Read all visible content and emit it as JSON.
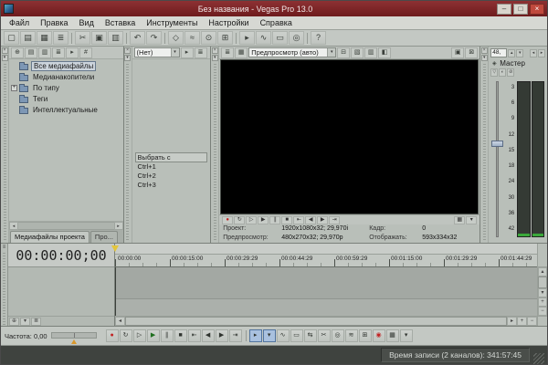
{
  "glyphs": {
    "minimize": "–",
    "maximize": "□",
    "close": "×",
    "pin": "▾",
    "tri_up": "▴",
    "tri_down": "▾",
    "tri_left": "◂",
    "tri_right": "▸",
    "up": "▲",
    "down": "▼",
    "left": "◀",
    "right": "▶",
    "plus": "+",
    "minus": "−",
    "hamburger": "≡",
    "expand": "+",
    "record": "●",
    "loop": "↻",
    "play_from_start": "▷",
    "play": "▶",
    "pause": "∥",
    "stop": "■",
    "go_to_start": "⇤",
    "prev_frame": "◀",
    "next_frame": "▶",
    "go_to_end": "⇥"
  },
  "titlebar": {
    "title": "Без названия - Vegas Pro 13.0"
  },
  "menu": {
    "items": [
      "Файл",
      "Правка",
      "Вид",
      "Вставка",
      "Инструменты",
      "Настройки",
      "Справка"
    ]
  },
  "toolbar": {
    "glyphs": [
      "▢",
      "▤",
      "▦",
      "≣",
      "✂",
      "▣",
      "▥",
      "↶",
      "↷",
      "◇",
      "≈",
      "⊙",
      "⊞",
      "▸",
      "∿",
      "▭",
      "◎",
      "?"
    ]
  },
  "project_media": {
    "toolbar_glyphs": [
      "⊕",
      "▤",
      "▥",
      "≣",
      "▸",
      "#"
    ],
    "tree_items": [
      "Все медиафайлы",
      "Медианакопители",
      "По типу",
      "Теги",
      "Интеллектуальные"
    ],
    "tab_active": "Медиафайлы проекта",
    "tab_other": "Про..."
  },
  "chooser": {
    "combo_value": "(Нет)",
    "toolbar_glyphs": [
      "▸",
      "≣"
    ],
    "list_title": "Выбрать с",
    "shortcuts": [
      "Ctrl+1",
      "Ctrl+2",
      "Ctrl+3"
    ]
  },
  "preview": {
    "left_glyphs": [
      "≣",
      "▦"
    ],
    "quality_combo": "Предпросмотр (авто)",
    "right_glyphs": [
      "⊟",
      "▧",
      "▥",
      "◧"
    ],
    "far_glyphs": [
      "▣",
      "⊠"
    ],
    "overlay_glyphs": [
      "▦",
      "▾"
    ],
    "info": {
      "project_label": "Проект:",
      "project_value": "1920x1080x32; 29,970i",
      "frame_label": "Кадр:",
      "frame_value": "0",
      "preview_label": "Предпросмотр:",
      "preview_value": "480x270x32; 29,970p",
      "display_label": "Отображать:",
      "display_value": "593x334x32"
    }
  },
  "master": {
    "range_value": "48,",
    "icon_glyph": "◈",
    "label": "Мастер",
    "ctl_glyphs": [
      "▽",
      "◐",
      "⊘"
    ],
    "scale": [
      "3",
      "6",
      "9",
      "12",
      "15",
      "18",
      "24",
      "30",
      "36",
      "42"
    ]
  },
  "timeline": {
    "timecode": "00:00:00;00",
    "ruler_labels": [
      "00:00:00",
      "00:00:15:00",
      "00:00:29:29",
      "00:00:44:29",
      "00:00:59:29",
      "00:01:15:00",
      "00:01:29:29",
      "00:01:44:29"
    ]
  },
  "bottom": {
    "rate_label": "Частота: 0,00",
    "left_glyphs": [
      "⊕",
      "▾",
      "≣"
    ],
    "tool_glyphs": [
      "▸",
      "▾",
      "∿",
      "▭",
      "⇆",
      "✂",
      "◎",
      "≋",
      "⊞",
      "◉",
      "▦",
      "▾"
    ]
  },
  "statusbar": {
    "record_time": "Время записи (2 каналов): 341:57:45"
  }
}
